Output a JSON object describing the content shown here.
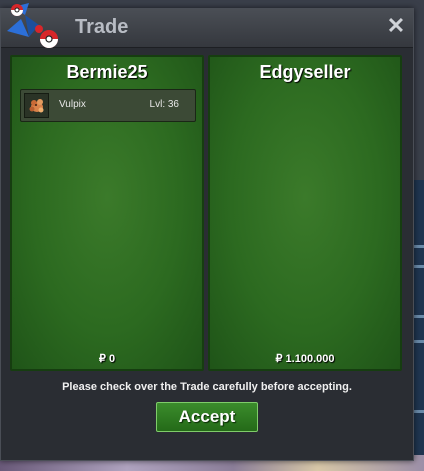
{
  "window": {
    "title": "Trade",
    "close_icon": "close-icon"
  },
  "left_panel": {
    "trainer": "Bermie25",
    "items": [
      {
        "icon": "vulpix-icon",
        "name": "Vulpix",
        "level": "Lvl: 36"
      }
    ],
    "money": "₽ 0"
  },
  "right_panel": {
    "trainer": "Edgyseller",
    "items": [],
    "money": "₽ 1.100.000"
  },
  "footer": {
    "notice": "Please check over the Trade carefully before accepting.",
    "accept_label": "Accept"
  },
  "colors": {
    "panel_green": "#2c6a20",
    "accept_green": "#2f7c22",
    "window_bg": "#2a2d33"
  }
}
